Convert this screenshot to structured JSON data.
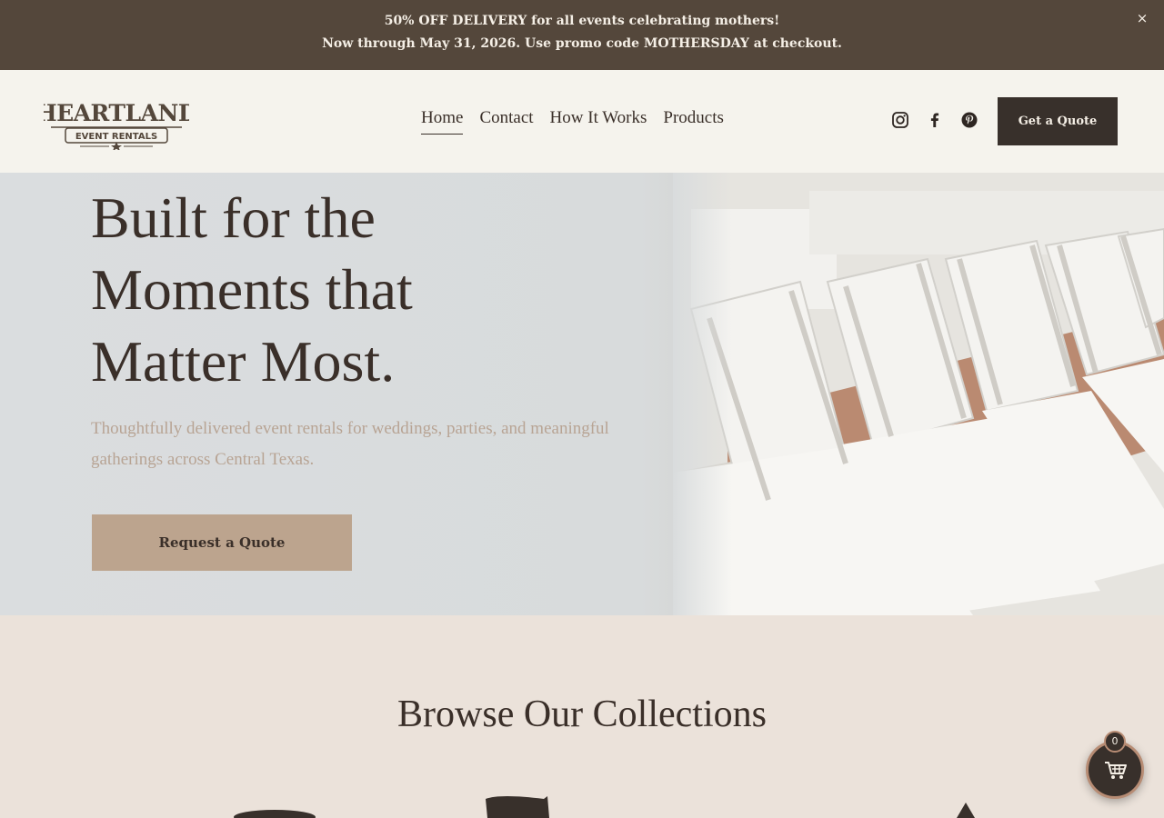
{
  "announcement": {
    "line1": "50% OFF DELIVERY for all events celebrating mothers!",
    "line2": "Now through May 31, 2026.  Use promo code MOTHERSDAY at checkout.",
    "close_label": "×"
  },
  "header": {
    "logo_top": "HEARTLAND",
    "logo_bottom": "EVENT RENTALS",
    "nav": [
      {
        "label": "Home",
        "active": true
      },
      {
        "label": "Contact"
      },
      {
        "label": "How It Works"
      },
      {
        "label": "Products"
      }
    ],
    "social_icons": [
      "instagram-icon",
      "facebook-icon",
      "pinterest-icon"
    ],
    "cta_label": "Get a Quote"
  },
  "hero": {
    "title_line1": "Built for the",
    "title_line2": "Moments that",
    "title_line3": "Matter Most.",
    "subtitle": "Thoughtfully delivered event rentals for weddings, parties, and meaningful gatherings across Central Texas.",
    "button_label": "Request a Quote"
  },
  "collections": {
    "title": "Browse Our Collections"
  },
  "cart": {
    "count": "0",
    "icon": "shopping-cart-icon"
  },
  "colors": {
    "announcement_bg": "#54473b",
    "header_bg": "#f5f3ed",
    "dark_button": "#38302b",
    "tan_button": "#bca48e",
    "section_bg": "#ebe2da"
  }
}
